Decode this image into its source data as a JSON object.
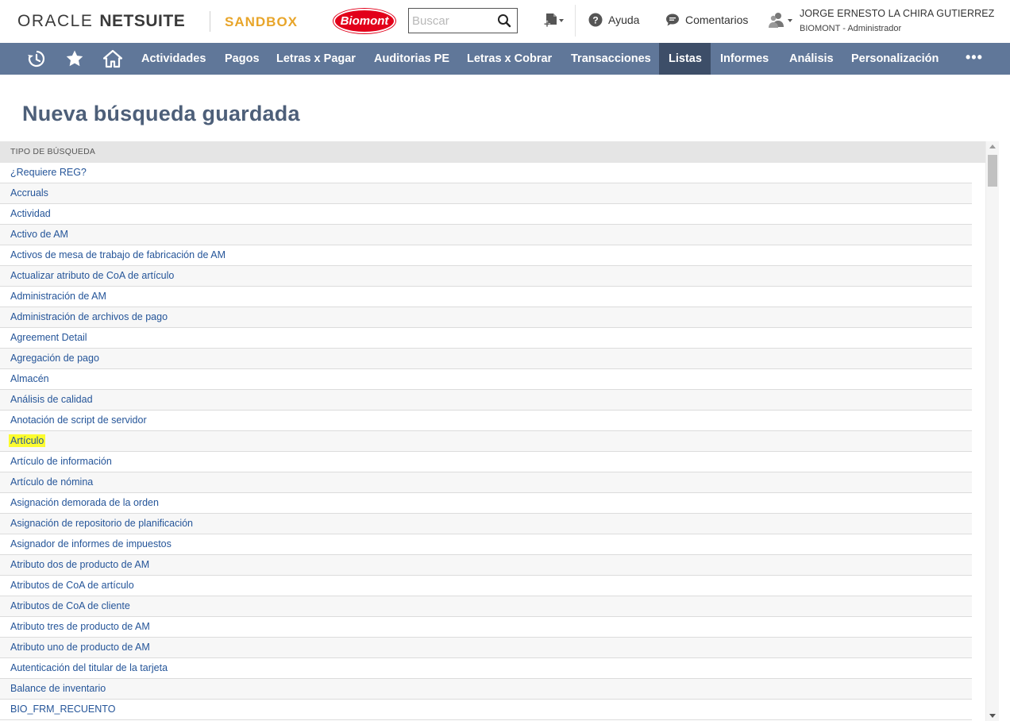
{
  "header": {
    "brand_oracle": "ORACLE",
    "brand_netsuite": "NETSUITE",
    "environment": "SANDBOX",
    "company_logo_text": "Biomont",
    "search_placeholder": "Buscar",
    "help_label": "Ayuda",
    "feedback_label": "Comentarios",
    "user_name": "JORGE ERNESTO LA CHIRA GUTIERREZ",
    "user_company": "BIOMONT",
    "user_role_separator": "-",
    "user_role": "Administrador"
  },
  "nav": {
    "icons": [
      "recent-icon",
      "star-icon",
      "home-icon"
    ],
    "items": [
      {
        "label": "Actividades"
      },
      {
        "label": "Pagos"
      },
      {
        "label": "Letras x Pagar"
      },
      {
        "label": "Auditorias PE"
      },
      {
        "label": "Letras x Cobrar"
      },
      {
        "label": "Transacciones"
      },
      {
        "label": "Listas",
        "active": true
      },
      {
        "label": "Informes"
      },
      {
        "label": "Análisis"
      },
      {
        "label": "Personalización"
      }
    ],
    "more_label": "•••"
  },
  "page": {
    "title": "Nueva búsqueda guardada"
  },
  "table": {
    "column_header": "TIPO DE BÚSQUEDA",
    "rows": [
      {
        "label": "¿Requiere REG?"
      },
      {
        "label": "Accruals"
      },
      {
        "label": "Actividad"
      },
      {
        "label": "Activo de AM"
      },
      {
        "label": "Activos de mesa de trabajo de fabricación de AM"
      },
      {
        "label": "Actualizar atributo de CoA de artículo"
      },
      {
        "label": "Administración de AM"
      },
      {
        "label": "Administración de archivos de pago"
      },
      {
        "label": "Agreement Detail"
      },
      {
        "label": "Agregación de pago"
      },
      {
        "label": "Almacén"
      },
      {
        "label": "Análisis de calidad"
      },
      {
        "label": "Anotación de script de servidor"
      },
      {
        "label": "Artículo",
        "highlighted": true
      },
      {
        "label": "Artículo de información"
      },
      {
        "label": "Artículo de nómina"
      },
      {
        "label": "Asignación demorada de la orden"
      },
      {
        "label": "Asignación de repositorio de planificación"
      },
      {
        "label": "Asignador de informes de impuestos"
      },
      {
        "label": "Atributo dos de producto de AM"
      },
      {
        "label": "Atributos de CoA de artículo"
      },
      {
        "label": "Atributos de CoA de cliente"
      },
      {
        "label": "Atributo tres de producto de AM"
      },
      {
        "label": "Atributo uno de producto de AM"
      },
      {
        "label": "Autenticación del titular de la tarjeta"
      },
      {
        "label": "Balance de inventario"
      },
      {
        "label": "BIO_FRM_RECUENTO"
      }
    ]
  },
  "colors": {
    "nav_bg": "#607799",
    "nav_active_bg": "#3d4e68",
    "title_color": "#4d5f79",
    "link_color": "#255599",
    "sandbox_color": "#e8a52a",
    "highlight": "#fcfc2f"
  }
}
